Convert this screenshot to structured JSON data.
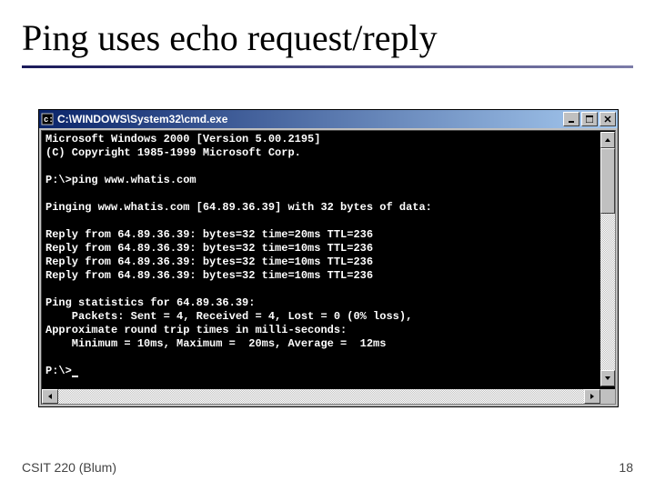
{
  "slide": {
    "title": "Ping uses echo request/reply",
    "footer_left": "CSIT 220 (Blum)",
    "footer_right": "18"
  },
  "window": {
    "title": "C:\\WINDOWS\\System32\\cmd.exe",
    "icons": {
      "app": "cmd-icon",
      "minimize": "minimize-icon",
      "maximize": "maximize-icon",
      "close": "close-icon",
      "scroll_up": "chevron-up-icon",
      "scroll_down": "chevron-down-icon",
      "scroll_left": "chevron-left-icon",
      "scroll_right": "chevron-right-icon"
    }
  },
  "terminal": {
    "lines": [
      "Microsoft Windows 2000 [Version 5.00.2195]",
      "(C) Copyright 1985-1999 Microsoft Corp.",
      "",
      "P:\\>ping www.whatis.com",
      "",
      "Pinging www.whatis.com [64.89.36.39] with 32 bytes of data:",
      "",
      "Reply from 64.89.36.39: bytes=32 time=20ms TTL=236",
      "Reply from 64.89.36.39: bytes=32 time=10ms TTL=236",
      "Reply from 64.89.36.39: bytes=32 time=10ms TTL=236",
      "Reply from 64.89.36.39: bytes=32 time=10ms TTL=236",
      "",
      "Ping statistics for 64.89.36.39:",
      "    Packets: Sent = 4, Received = 4, Lost = 0 (0% loss),",
      "Approximate round trip times in milli-seconds:",
      "    Minimum = 10ms, Maximum =  20ms, Average =  12ms",
      "",
      "P:\\>"
    ]
  }
}
